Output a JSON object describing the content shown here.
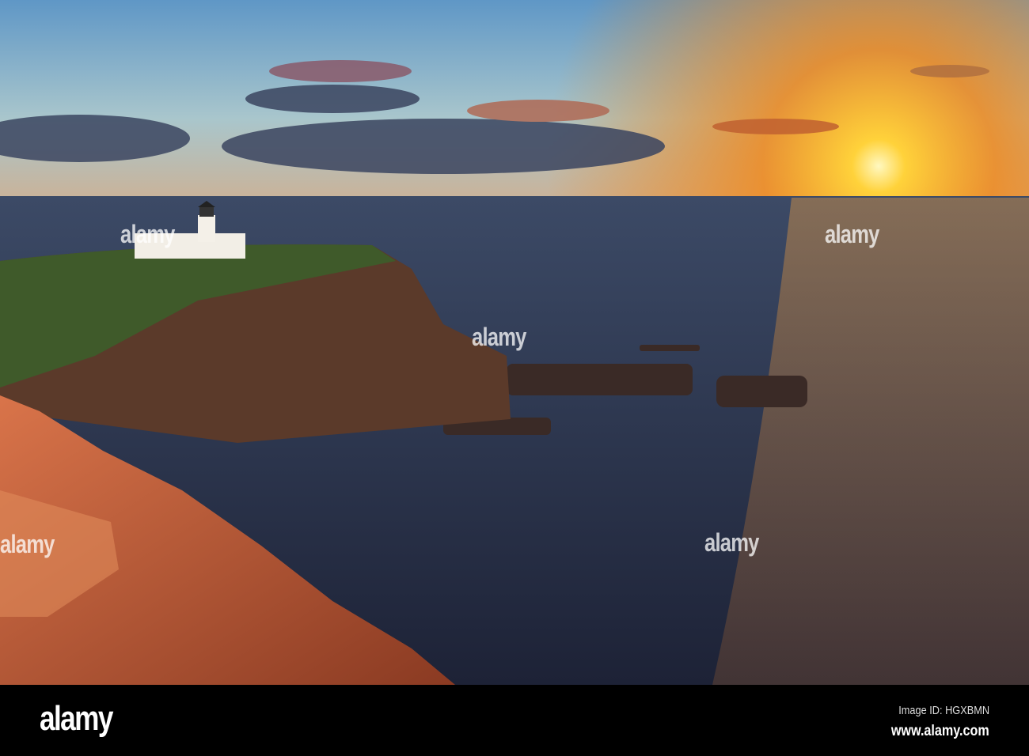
{
  "photo": {
    "subject": "lighthouse on sea cliff at sunset",
    "colors": {
      "sky_top": "#6f9fc4",
      "sky_horizon": "#f0a24a",
      "sun": "#fff4b0",
      "sea": "#2a3148",
      "cliff_grass": "#3f5a2a",
      "rock": "#c8603a"
    }
  },
  "watermark": {
    "text": "alamy"
  },
  "footer": {
    "logo": "alamy",
    "image_id": "Image ID: HGXBMN",
    "url": "www.alamy.com"
  }
}
